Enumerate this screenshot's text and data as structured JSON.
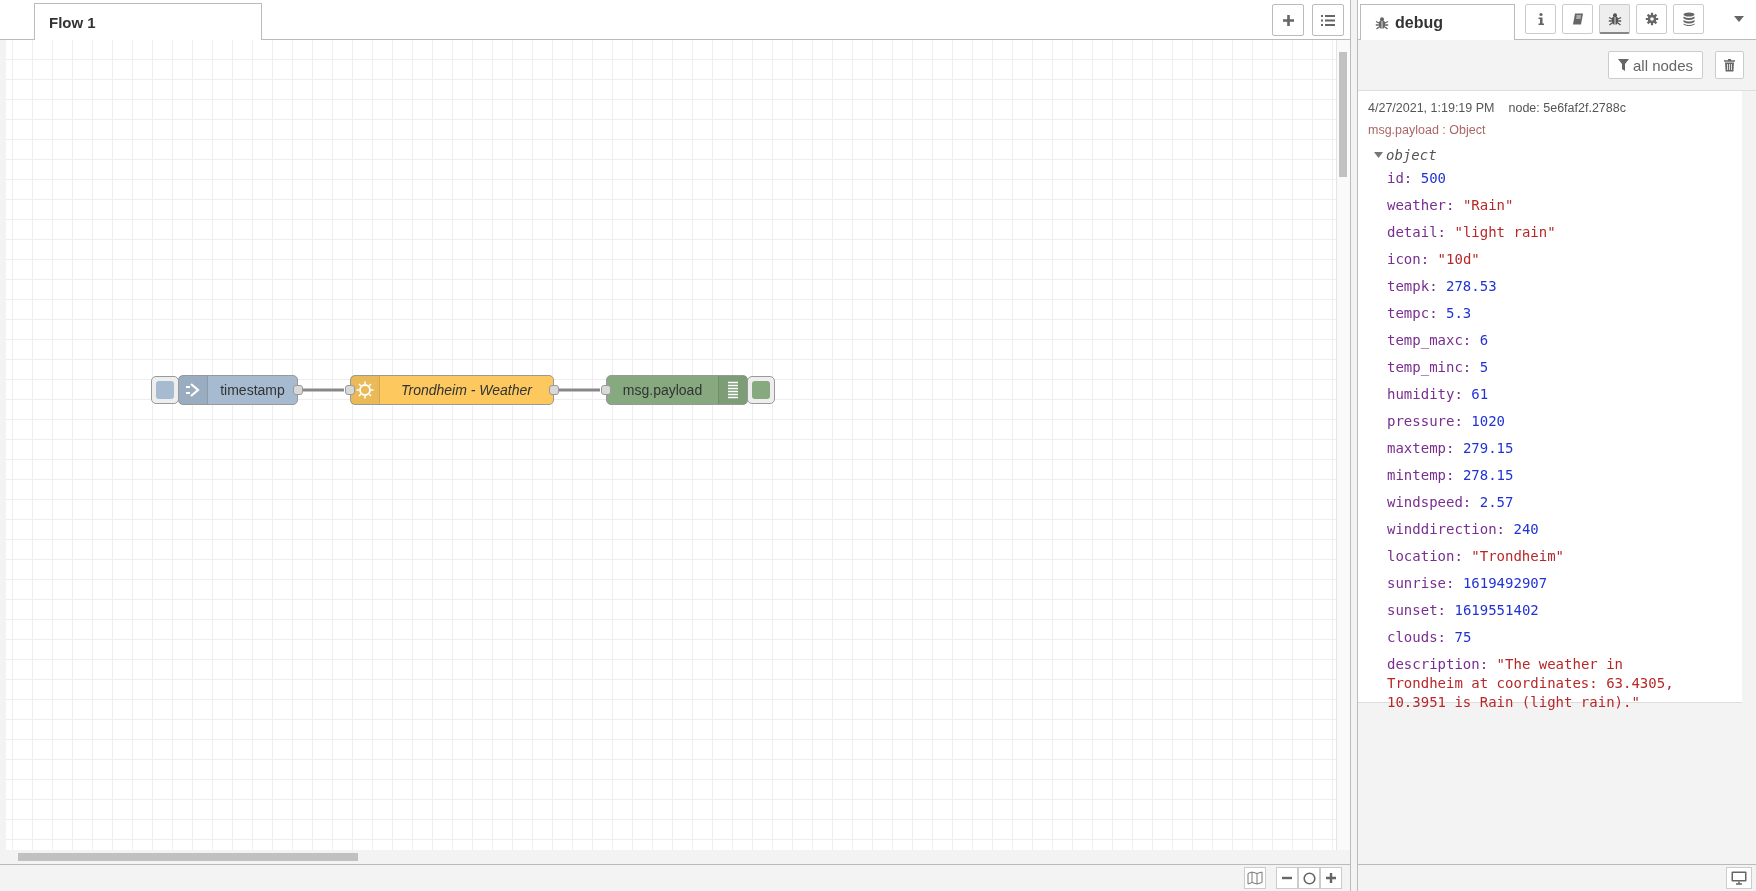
{
  "workspace": {
    "tabs": [
      {
        "label": "Flow 1",
        "selected": true
      }
    ],
    "nodes": [
      {
        "kind": "inject",
        "label": "timestamp"
      },
      {
        "kind": "function",
        "label": "Trondheim - Weather"
      },
      {
        "kind": "debug",
        "label": "msg.payload"
      }
    ]
  },
  "sidebar": {
    "tabs": [
      {
        "label": "debug",
        "selected": true
      }
    ],
    "icon_tabs": [
      {
        "kind": "info",
        "selected": false
      },
      {
        "kind": "help",
        "selected": false
      },
      {
        "kind": "debug",
        "selected": true
      },
      {
        "kind": "config",
        "selected": false
      },
      {
        "kind": "context",
        "selected": false
      }
    ],
    "filter_button": "all nodes",
    "message": {
      "timestamp": "4/27/2021, 1:19:19 PM",
      "node": "node: 5e6faf2f.2788c",
      "topic": "msg.payload : Object",
      "root": {
        "label": "object",
        "expanded": true
      },
      "properties": [
        {
          "key": "id:",
          "value": "500",
          "kind": "number"
        },
        {
          "key": "weather:",
          "value": "\"Rain\"",
          "kind": "string"
        },
        {
          "key": "detail:",
          "value": "\"light rain\"",
          "kind": "string"
        },
        {
          "key": "icon:",
          "value": "\"10d\"",
          "kind": "string"
        },
        {
          "key": "tempk:",
          "value": "278.53",
          "kind": "number"
        },
        {
          "key": "tempc:",
          "value": "5.3",
          "kind": "number"
        },
        {
          "key": "temp_maxc:",
          "value": "6",
          "kind": "number"
        },
        {
          "key": "temp_minc:",
          "value": "5",
          "kind": "number"
        },
        {
          "key": "humidity:",
          "value": "61",
          "kind": "number"
        },
        {
          "key": "pressure:",
          "value": "1020",
          "kind": "number"
        },
        {
          "key": "maxtemp:",
          "value": "279.15",
          "kind": "number"
        },
        {
          "key": "mintemp:",
          "value": "278.15",
          "kind": "number"
        },
        {
          "key": "windspeed:",
          "value": "2.57",
          "kind": "number"
        },
        {
          "key": "winddirection:",
          "value": "240",
          "kind": "number"
        },
        {
          "key": "location:",
          "value": "\"Trondheim\"",
          "kind": "string"
        },
        {
          "key": "sunrise:",
          "value": "1619492907",
          "kind": "number"
        },
        {
          "key": "sunset:",
          "value": "1619551402",
          "kind": "number"
        },
        {
          "key": "clouds:",
          "value": "75",
          "kind": "number"
        },
        {
          "key": "description:",
          "value": "\"The weather in Trondheim at coordinates: 63.4305, 10.3951 is Rain (light rain).\"",
          "kind": "string"
        }
      ]
    }
  }
}
